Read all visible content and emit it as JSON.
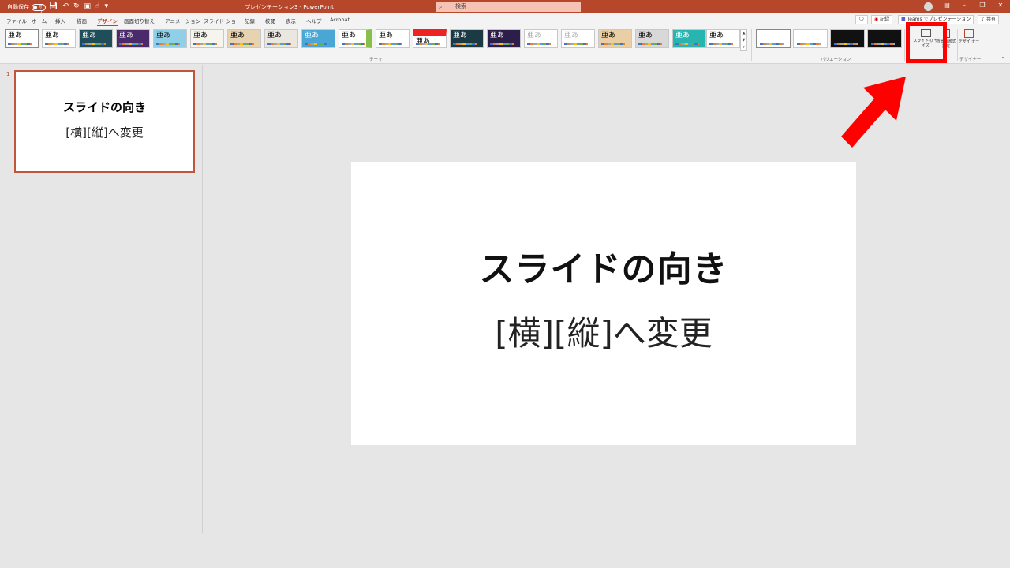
{
  "titlebar": {
    "autosave_label": "自動保存",
    "autosave_state": "オフ",
    "doc_title": "プレゼンテーション3  -  PowerPoint",
    "search_placeholder": "検索",
    "qat_icons": [
      "save-icon",
      "undo-icon",
      "redo-icon",
      "present-icon",
      "touch-mode-icon",
      "customize-icon"
    ],
    "window_controls": [
      "ribbon-display-icon",
      "minimize-icon",
      "restore-icon",
      "close-icon"
    ]
  },
  "tabs": {
    "items": [
      "ファイル",
      "ホーム",
      "挿入",
      "描画",
      "デザイン",
      "画面切り替え",
      "アニメーション",
      "スライド ショー",
      "記録",
      "校閲",
      "表示",
      "ヘルプ",
      "Acrobat"
    ],
    "active": "デザイン",
    "comment_icon": "comment-icon",
    "record_label": "記録",
    "teams_label": "Teams でプレゼンテーション",
    "share_label": "共有"
  },
  "ribbon": {
    "theme_sample_text": "亜あ",
    "themes_group_label": "テーマ",
    "variants_group_label": "バリエーション",
    "slide_size_label": "スライドの サイズ",
    "format_bg_label": "背景の書式設定",
    "designer_label": "デザイ ナー",
    "designer_group_label": "デザイナー"
  },
  "thumbnail": {
    "number": "1",
    "title": "スライドの向き",
    "subtitle": "[横][縦]へ変更"
  },
  "slide": {
    "title": "スライドの向き",
    "subtitle": "[横][縦]へ変更"
  },
  "colors": {
    "accent": "#b7472a",
    "highlight": "#ff0000"
  }
}
